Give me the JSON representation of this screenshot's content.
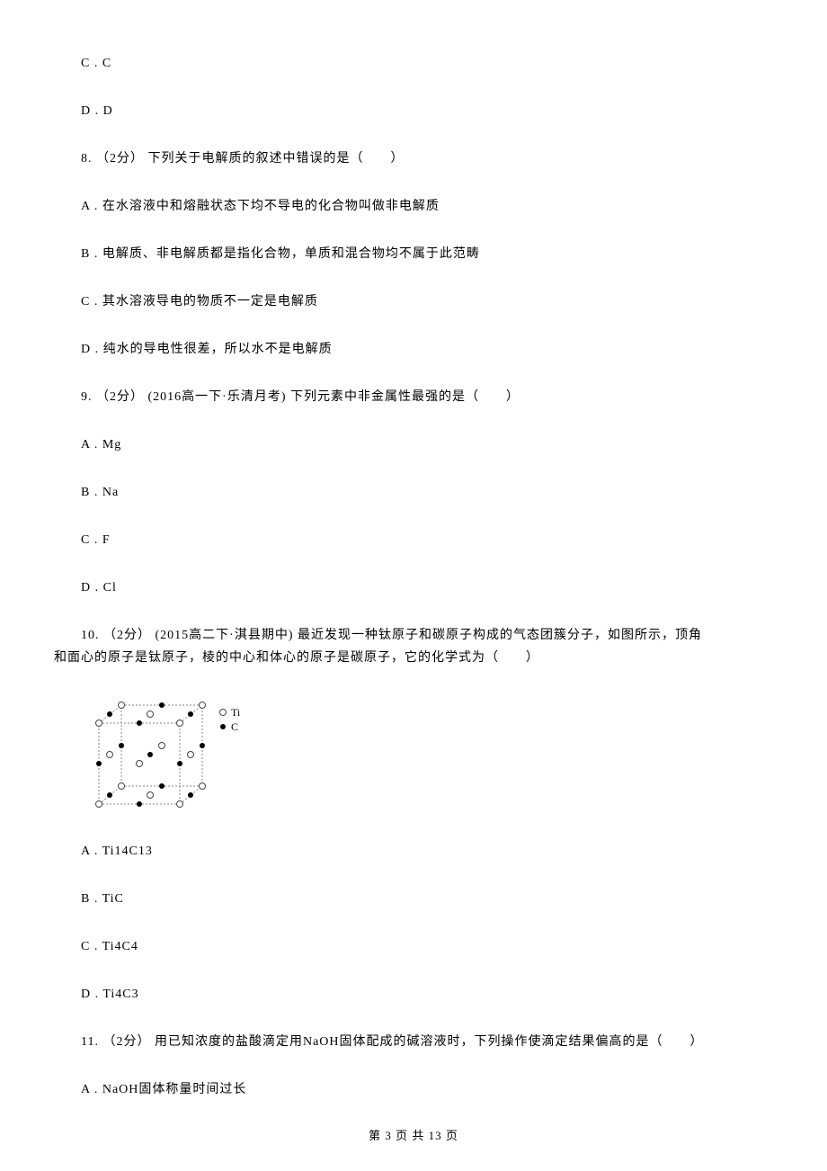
{
  "q7": {
    "optC": "C . C",
    "optD": "D . D"
  },
  "q8": {
    "stem": "8. （2分） 下列关于电解质的叙述中错误的是（　　）",
    "optA": "A . 在水溶液中和熔融状态下均不导电的化合物叫做非电解质",
    "optB": "B . 电解质、非电解质都是指化合物，单质和混合物均不属于此范畴",
    "optC": "C . 其水溶液导电的物质不一定是电解质",
    "optD": "D . 纯水的导电性很差，所以水不是电解质"
  },
  "q9": {
    "stem": "9. （2分） (2016高一下·乐清月考) 下列元素中非金属性最强的是（　　）",
    "optA": "A . Mg",
    "optB": "B . Na",
    "optC": "C . F",
    "optD": "D . Cl"
  },
  "q10": {
    "stem_line1": "10. （2分） (2015高二下·淇县期中) 最近发现一种钛原子和碳原子构成的气态团簇分子，如图所示，顶角",
    "stem_line2": "和面心的原子是钛原子，棱的中心和体心的原子是碳原子，它的化学式为（　　）",
    "legend_ti": "Ti",
    "legend_c": "C",
    "optA": "A . Ti14C13",
    "optB": "B . TiC",
    "optC": "C . Ti4C4",
    "optD": "D . Ti4C3"
  },
  "q11": {
    "stem": "11. （2分） 用已知浓度的盐酸滴定用NaOH固体配成的碱溶液时，下列操作使滴定结果偏高的是（　　）",
    "optA": "A . NaOH固体称量时间过长"
  },
  "footer": "第 3 页 共 13 页"
}
